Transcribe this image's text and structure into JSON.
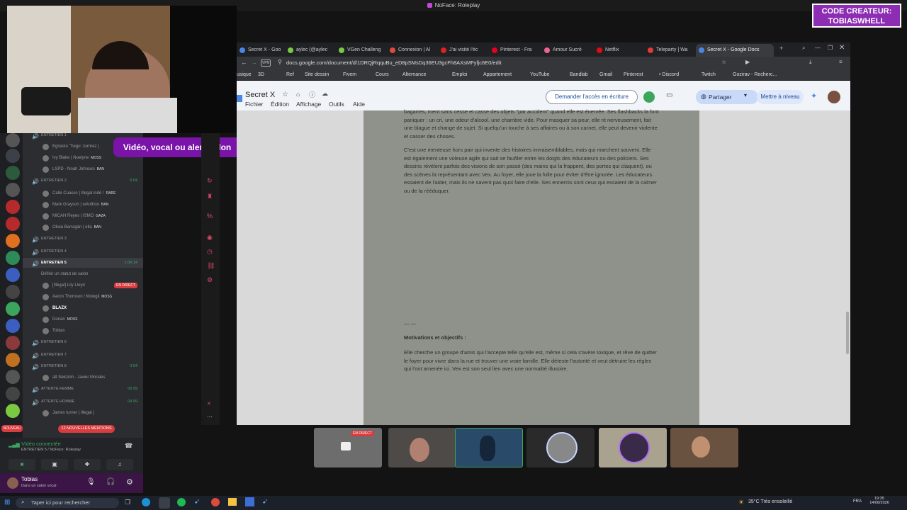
{
  "window_title": "NoFace: Roleplay",
  "creator_badge": {
    "line1": "CODE CREATEUR:",
    "line2": "TOBIASWHELL"
  },
  "donate_banner": "Vidéo, vocal ou alerte !don",
  "discord": {
    "channels": [
      {
        "type": "cat",
        "label": "ENTRETIEN 1"
      },
      {
        "type": "usr",
        "label": "Egnasto 'Tiego' Jurrirez |"
      },
      {
        "type": "usr",
        "label": "Ivy Blake | Noelyne",
        "tag": "MOSS"
      },
      {
        "type": "usr",
        "label": "LSPD - Noah Johnson",
        "tag": "BAN"
      },
      {
        "type": "cat",
        "label": "ENTRETIEN 2",
        "time": "5:04"
      },
      {
        "type": "usr",
        "label": "Calle Cuaces | Illegal indé !",
        "tag": "RARE"
      },
      {
        "type": "usr",
        "label": "Mark Grayson | wAnthoo",
        "tag": "BAN"
      },
      {
        "type": "usr",
        "label": "MICAH Reyes | ISMO",
        "tag": "GAZA"
      },
      {
        "type": "usr",
        "label": "Olivia Barragán | ella",
        "tag": "BAN"
      },
      {
        "type": "cat",
        "label": "ENTRETIEN 3"
      },
      {
        "type": "cat",
        "label": "ENTRETIEN 4"
      },
      {
        "type": "cat",
        "label": "ENTRETIEN 5",
        "time": "1:06:14"
      },
      {
        "type": "sub",
        "label": "Définir un statut de salon"
      },
      {
        "type": "usr",
        "label": "[Illégal] Lily Lloyd",
        "live": "EN DIRECT"
      },
      {
        "type": "usr",
        "label": "Aaron Thomson / Mowgli",
        "tag": "MOSS"
      },
      {
        "type": "usr",
        "label": "BLAZX"
      },
      {
        "type": "usr",
        "label": "Dorian",
        "tag": "MOSS"
      },
      {
        "type": "usr",
        "label": "Tobias"
      },
      {
        "type": "cat",
        "label": "ENTRETIEN 6"
      },
      {
        "type": "cat",
        "label": "ENTRETIEN 7"
      },
      {
        "type": "cat",
        "label": "ENTRETIEN 8",
        "time": "0:54"
      },
      {
        "type": "usr",
        "label": "att Nekzioh - Javier Morales"
      },
      {
        "type": "cat",
        "label": "ATTENTE FEMME",
        "time": "00  99"
      },
      {
        "type": "cat",
        "label": "ATTENTE HOMME",
        "time": "04  99"
      },
      {
        "type": "usr",
        "label": "James turner | Illegal |"
      }
    ],
    "new_mentions": "12 NOUVELLES MENTIONS",
    "new_badge": "NOUVEAU",
    "voice_status": "Vidéo connectée",
    "voice_channel": "ENTRETIEN 5 / NoFace: Roleplay",
    "user_name": "Tobias",
    "user_status": "Dans un salon vocal"
  },
  "browser": {
    "tabs": [
      {
        "label": "Secret X - Goo",
        "color": "#4a86e8"
      },
      {
        "label": "aylec (@aylec",
        "color": "#7ac943"
      },
      {
        "label": "VGen Challeng",
        "color": "#7ac943"
      },
      {
        "label": "Connexion | Al",
        "color": "#e04a3a"
      },
      {
        "label": "J'ai visité l'éc",
        "color": "#e02020"
      },
      {
        "label": "Pinterest - Fra",
        "color": "#e60023"
      },
      {
        "label": "Amour Sucré",
        "color": "#f06292"
      },
      {
        "label": "Netflix",
        "color": "#e50914"
      },
      {
        "label": "Teleparty | Wa",
        "color": "#e53935"
      },
      {
        "label": "Secret X - Google Docs",
        "color": "#4a86e8",
        "active": true
      }
    ],
    "url": "docs.google.com/document/d/1DRQjRqquBu_eD8pSMsDq36EU3gcFh8AXsMFyfjc6E0/edit",
    "bookmarks": [
      "usique",
      "3D",
      "Ref",
      "Site dessin",
      "Fivem",
      "Cours",
      "Alternance",
      "Emploi",
      "Appartement",
      "YouTube",
      "Bandlab",
      "Gmail",
      "Pinterest",
      "• Discord",
      "Twitch",
      "Gozirav - Recherc..."
    ]
  },
  "docs": {
    "title": "Secret X",
    "menus": [
      "Fichier",
      "Édition",
      "Affichage",
      "Outils",
      "Aide"
    ],
    "request_access": "Demander l'accès en écriture",
    "share": "Partager",
    "upgrade": "Mettre à niveau",
    "paragraphs": [
      "bagarres, ment sans cesse et casse des objets \"par accident\" quand elle est énervée. Ses flashbacks la font paniquer : un cri, une odeur d'alcool, une chambre vide. Pour masquer sa peur, elle rit nerveusement, fait une blague et change de sujet. Si quelqu'un touche à ses affaires ou à son carnet, elle peut devenir violente et casser des choses.",
      "C'est une menteuse hors pair qui invente des histoires invraisemblables, mais qui marchent souvent. Elle est également une voleuse agile qui sait se faufiler entre les doigts des éducateurs ou des policiers. Ses dessins révèlent parfois des visions de son passé (des mains qui la frappent, des portes qui claquent), ou des scènes la représentant avec Vex. Au foyer, elle joue la folle pour éviter d'être ignorée. Les éducateurs essaient de l'aider, mais ils ne savent pas quoi faire d'elle. Ses ennemis sont ceux qui essaient de la calmer ou de la rééduquer."
    ],
    "separator": "— —",
    "heading": "Motivations et objectifs :",
    "paragraph3": "Elle cherche un groupe d'amis qui l'accepte telle qu'elle est, même si cela s'avère toxique, et rêve de quitter le foyer pour vivre dans la rue et trouver une vraie famille. Elle déteste l'autorité et veut détruire les règles qui l'ont amenée ici. Vex est son seul lien avec une normalité illusoire."
  },
  "video_strip": {
    "live_label": "EN DIRECT"
  },
  "taskbar": {
    "search_placeholder": "Taper ici pour rechercher",
    "weather": "35°C  Très ensoleillé",
    "lang": "FRA",
    "time": "19:35",
    "date": "14/08/2026"
  }
}
